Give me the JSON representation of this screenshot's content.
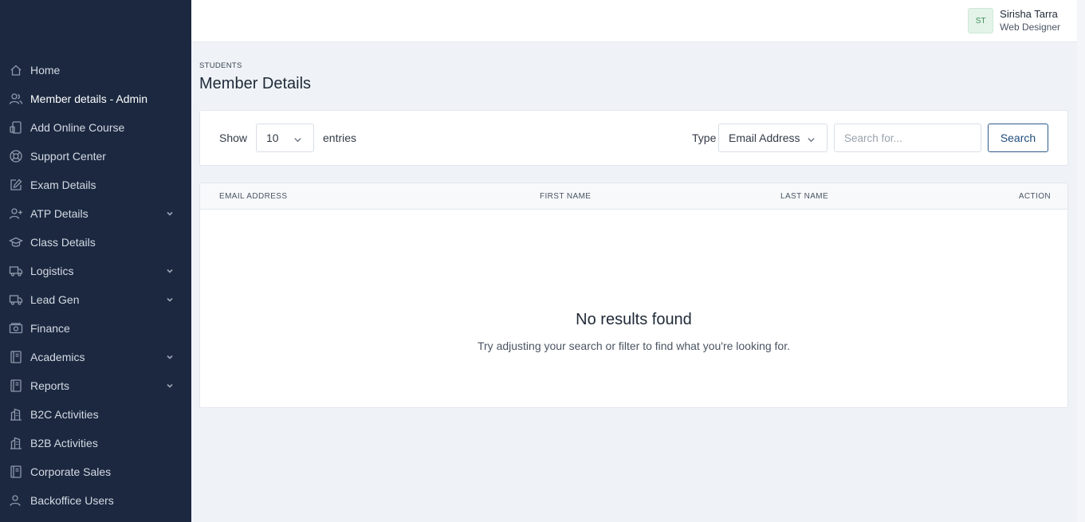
{
  "sidebar": {
    "items": [
      {
        "label": "Home",
        "icon": "home-icon",
        "active": false,
        "has_submenu": false
      },
      {
        "label": "Member details - Admin",
        "icon": "users-icon",
        "active": true,
        "has_submenu": false
      },
      {
        "label": "Add Online Course",
        "icon": "device-icon",
        "active": false,
        "has_submenu": false
      },
      {
        "label": "Support Center",
        "icon": "lifebuoy-icon",
        "active": false,
        "has_submenu": false
      },
      {
        "label": "Exam Details",
        "icon": "edit-icon",
        "active": false,
        "has_submenu": false
      },
      {
        "label": "ATP Details",
        "icon": "user-plus-icon",
        "active": false,
        "has_submenu": true
      },
      {
        "label": "Class Details",
        "icon": "graduation-cap-icon",
        "active": false,
        "has_submenu": false
      },
      {
        "label": "Logistics",
        "icon": "truck-icon",
        "active": false,
        "has_submenu": true
      },
      {
        "label": "Lead Gen",
        "icon": "truck-icon",
        "active": false,
        "has_submenu": true
      },
      {
        "label": "Finance",
        "icon": "money-icon",
        "active": false,
        "has_submenu": false
      },
      {
        "label": "Academics",
        "icon": "book-icon",
        "active": false,
        "has_submenu": true
      },
      {
        "label": "Reports",
        "icon": "book-icon",
        "active": false,
        "has_submenu": true
      },
      {
        "label": "B2C Activities",
        "icon": "building-icon",
        "active": false,
        "has_submenu": false
      },
      {
        "label": "B2B Activities",
        "icon": "building-icon",
        "active": false,
        "has_submenu": false
      },
      {
        "label": "Corporate Sales",
        "icon": "book-icon",
        "active": false,
        "has_submenu": false
      },
      {
        "label": "Backoffice Users",
        "icon": "user-icon",
        "active": false,
        "has_submenu": false
      }
    ]
  },
  "user": {
    "initials": "ST",
    "name": "Sirisha Tarra",
    "role": "Web Designer"
  },
  "page": {
    "breadcrumb": "STUDENTS",
    "title": "Member Details"
  },
  "filters": {
    "show_label": "Show",
    "entries_value": "10",
    "entries_label": "entries",
    "type_label": "Type",
    "type_value": "Email Address",
    "search_placeholder": "Search for...",
    "search_value": "",
    "search_button": "Search"
  },
  "table": {
    "columns": [
      "EMAIL ADDRESS",
      "FIRST NAME",
      "LAST NAME",
      "ACTION"
    ],
    "rows": [],
    "empty_title": "No results found",
    "empty_message": "Try adjusting your search or filter to find what you're looking for."
  },
  "colors": {
    "sidebar_bg": "#1b2840",
    "page_bg": "#eff3f7",
    "accent": "#224e7d",
    "avatar_bg": "#e3f3e8"
  }
}
